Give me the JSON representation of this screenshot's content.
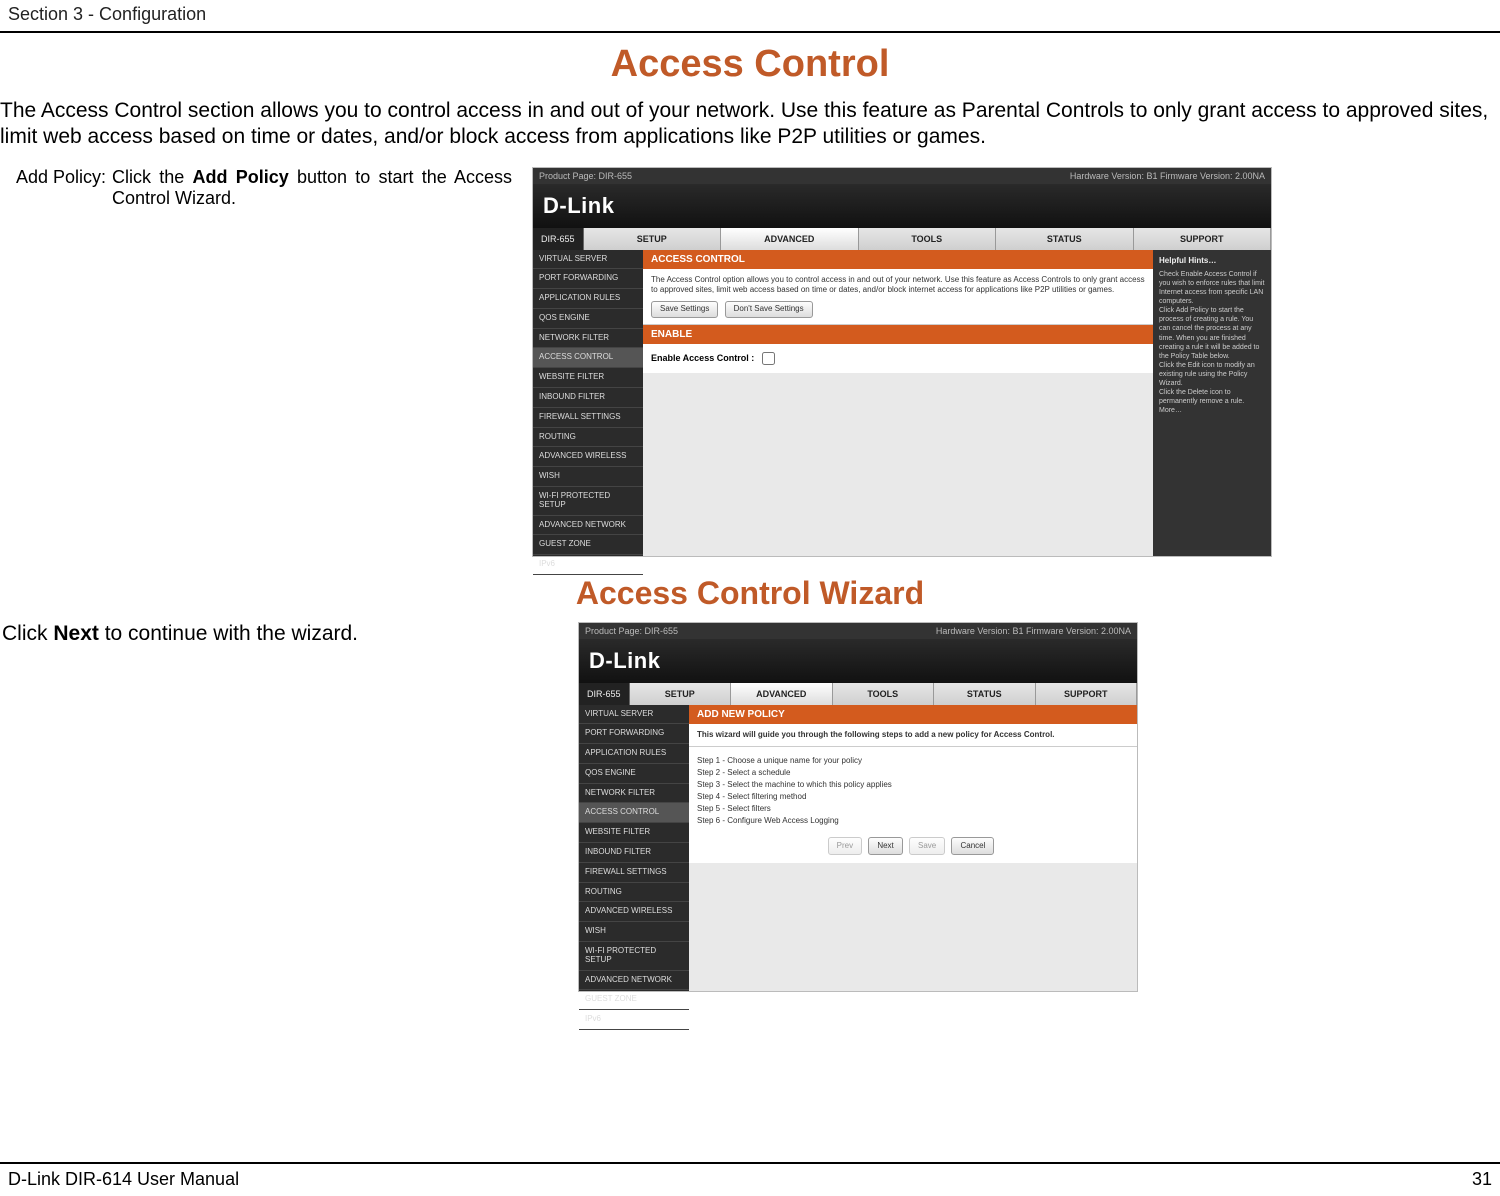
{
  "header": {
    "section": "Section 3 - Configuration"
  },
  "title": "Access Control",
  "intro": "The Access Control section allows you to control access in and out of your network. Use this feature as Parental Controls to only grant access to approved sites, limit web access based on time or dates, and/or block access from applications like P2P utilities or games.",
  "addPolicy": {
    "label": "Add Policy:",
    "desc_pre": "Click the ",
    "desc_bold": "Add Policy",
    "desc_post": " button to start the Access Control Wizard."
  },
  "screenshot1": {
    "topbar_left": "Product Page: DIR-655",
    "topbar_right": "Hardware Version: B1    Firmware Version: 2.00NA",
    "brand": "D-Link",
    "device": "DIR-655",
    "tabs": [
      "SETUP",
      "ADVANCED",
      "TOOLS",
      "STATUS",
      "SUPPORT"
    ],
    "active_tab": 1,
    "side": [
      "VIRTUAL SERVER",
      "PORT FORWARDING",
      "APPLICATION RULES",
      "QOS ENGINE",
      "NETWORK FILTER",
      "ACCESS CONTROL",
      "WEBSITE FILTER",
      "INBOUND FILTER",
      "FIREWALL SETTINGS",
      "ROUTING",
      "ADVANCED WIRELESS",
      "WISH",
      "WI-FI PROTECTED SETUP",
      "ADVANCED NETWORK",
      "GUEST ZONE",
      "IPv6"
    ],
    "active_side": 5,
    "panel_title": "ACCESS CONTROL",
    "panel_desc": "The Access Control option allows you to control access in and out of your network. Use this feature as Access Controls to only grant access to approved sites, limit web access based on time or dates, and/or block internet access for applications like P2P utilities or games.",
    "save_btn": "Save Settings",
    "dont_save_btn": "Don't Save Settings",
    "enable_title": "ENABLE",
    "enable_label": "Enable Access Control :",
    "help_title": "Helpful Hints…",
    "help_text": "Check Enable Access Control if you wish to enforce rules that limit Internet access from specific LAN computers.\nClick Add Policy to start the process of creating a rule. You can cancel the process at any time. When you are finished creating a rule it will be added to the Policy Table below.\nClick the Edit icon to modify an existing rule using the Policy Wizard.\nClick the Delete icon to permanently remove a rule.\nMore…"
  },
  "subtitle": "Access Control Wizard",
  "wizard_text_pre": "Click ",
  "wizard_text_bold": "Next",
  "wizard_text_post": " to continue with the wizard.",
  "screenshot2": {
    "topbar_left": "Product Page: DIR-655",
    "topbar_right": "Hardware Version: B1    Firmware Version: 2.00NA",
    "brand": "D-Link",
    "device": "DIR-655",
    "tabs": [
      "SETUP",
      "ADVANCED",
      "TOOLS",
      "STATUS",
      "SUPPORT"
    ],
    "active_tab": 1,
    "side": [
      "VIRTUAL SERVER",
      "PORT FORWARDING",
      "APPLICATION RULES",
      "QOS ENGINE",
      "NETWORK FILTER",
      "ACCESS CONTROL",
      "WEBSITE FILTER",
      "INBOUND FILTER",
      "FIREWALL SETTINGS",
      "ROUTING",
      "ADVANCED WIRELESS",
      "WISH",
      "WI-FI PROTECTED SETUP",
      "ADVANCED NETWORK",
      "GUEST ZONE",
      "IPv6"
    ],
    "active_side": 5,
    "panel_title": "ADD NEW POLICY",
    "panel_desc": "This wizard will guide you through the following steps to add a new policy for Access Control.",
    "steps": [
      "Step 1 - Choose a unique name for your policy",
      "Step 2 - Select a schedule",
      "Step 3 - Select the machine to which this policy applies",
      "Step 4 - Select filtering method",
      "Step 5 - Select filters",
      "Step 6 - Configure Web Access Logging"
    ],
    "btn_prev": "Prev",
    "btn_next": "Next",
    "btn_save": "Save",
    "btn_cancel": "Cancel"
  },
  "footer": {
    "left": "D-Link DIR-614 User Manual",
    "right": "31"
  }
}
